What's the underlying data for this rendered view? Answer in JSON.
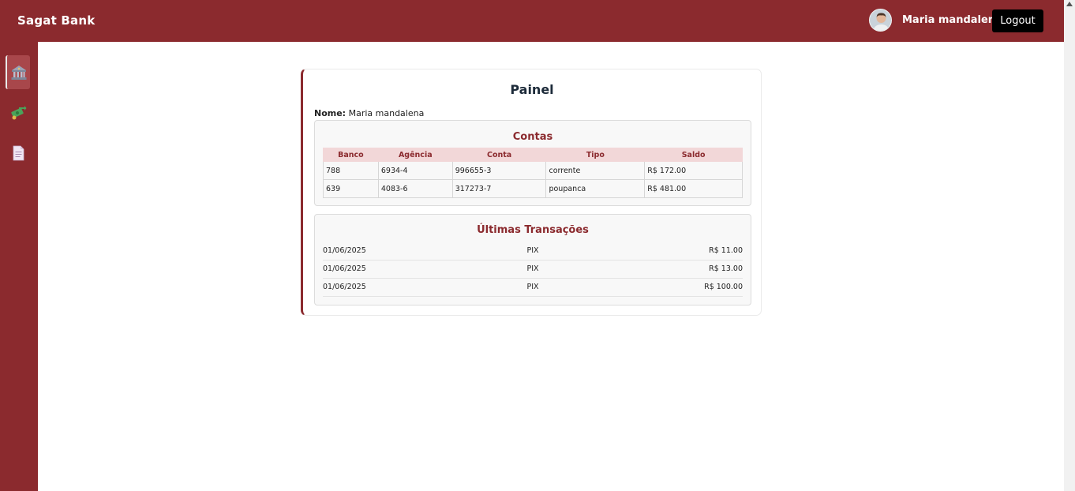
{
  "header": {
    "brand": "Sagat Bank",
    "user_name": "Maria mandalena",
    "logout_label": "Logout"
  },
  "sidebar": {
    "items": [
      {
        "icon": "bank-icon",
        "active": true
      },
      {
        "icon": "money-transfer-icon",
        "active": false
      },
      {
        "icon": "document-icon",
        "active": false
      }
    ]
  },
  "card": {
    "title": "Painel",
    "name_label": "Nome:",
    "name_value": "Maria mandalena"
  },
  "accounts": {
    "title": "Contas",
    "columns": [
      "Banco",
      "Agência",
      "Conta",
      "Tipo",
      "Saldo"
    ],
    "rows": [
      [
        "788",
        "6934-4",
        "996655-3",
        "corrente",
        "R$ 172.00"
      ],
      [
        "639",
        "4083-6",
        "317273-7",
        "poupanca",
        "R$ 481.00"
      ]
    ]
  },
  "transactions": {
    "title": "Últimas Transações",
    "rows": [
      {
        "date": "01/06/2025",
        "type": "PIX",
        "amount": "R$ 11.00"
      },
      {
        "date": "01/06/2025",
        "type": "PIX",
        "amount": "R$ 13.00"
      },
      {
        "date": "01/06/2025",
        "type": "PIX",
        "amount": "R$ 100.00"
      }
    ]
  },
  "colors": {
    "brand": "#8b2a2e",
    "table_header_bg": "#f2d7d8",
    "logout_bg": "#000000"
  }
}
